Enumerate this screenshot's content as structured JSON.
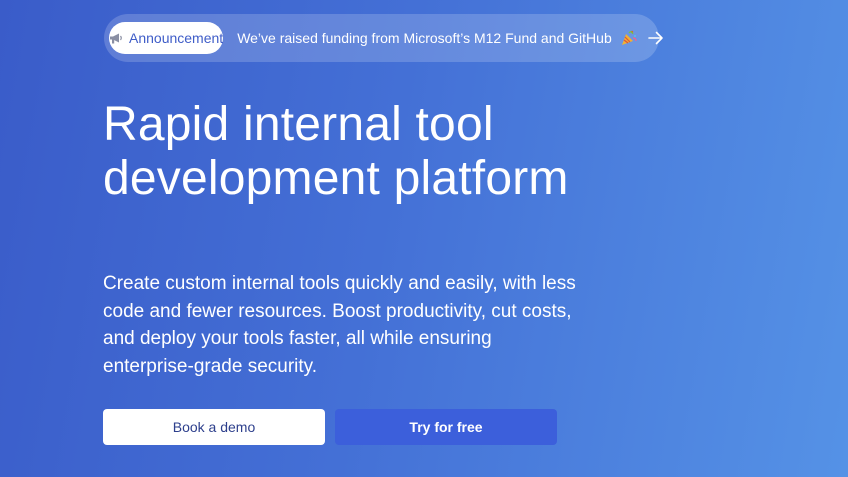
{
  "announcement": {
    "badge_label": "Announcement",
    "badge_icon": "megaphone-icon",
    "text": "We’ve raised funding from Microsoft’s M12 Fund and GitHub",
    "emoji_icon": "party-popper-icon",
    "arrow_icon": "arrow-right-icon"
  },
  "hero": {
    "headline": "Rapid internal tool development platform",
    "description": "Create custom internal tools quickly and easily, with less code and fewer resources. Boost productivity, cut costs, and deploy your tools faster, all while ensuring enterprise-grade security."
  },
  "cta": {
    "demo_label": "Book a demo",
    "try_label": "Try for free"
  },
  "colors": {
    "background_start": "#3a5cc9",
    "background_end": "#5592e6",
    "primary_button": "#3c5fdb",
    "badge_text": "#3f5dc8"
  }
}
